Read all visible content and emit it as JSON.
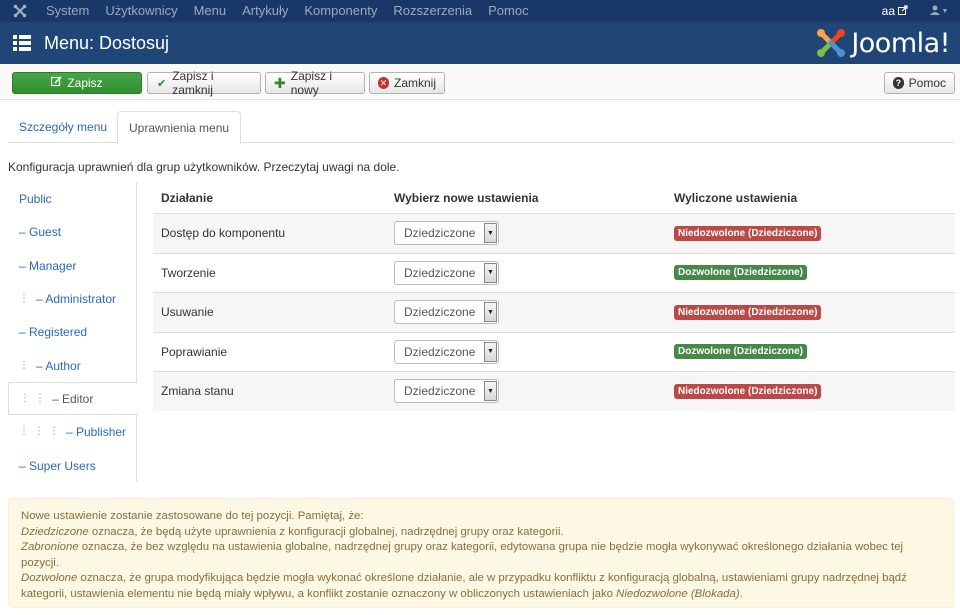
{
  "topnav": {
    "items": [
      "System",
      "Użytkownicy",
      "Menu",
      "Artykuły",
      "Komponenty",
      "Rozszerzenia",
      "Pomoc"
    ],
    "site_label": "aa"
  },
  "header": {
    "title": "Menu: Dostosuj",
    "logo_text": "Joomla!"
  },
  "toolbar": {
    "save": "Zapisz",
    "save_close": "Zapisz i zamknij",
    "save_new": "Zapisz i nowy",
    "close": "Zamknij",
    "help": "Pomoc"
  },
  "tabs": [
    "Szczegóły menu",
    "Uprawnienia menu"
  ],
  "intro": "Konfiguracja uprawnień dla grup użytkowników. Przeczytaj uwagi na dole.",
  "groups": [
    {
      "label": "Public",
      "depth": 0,
      "prefix": ""
    },
    {
      "label": "– Guest",
      "depth": 0,
      "prefix": ""
    },
    {
      "label": "– Manager",
      "depth": 0,
      "prefix": ""
    },
    {
      "label": "– Administrator",
      "depth": 1,
      "prefix": "⋮"
    },
    {
      "label": "– Registered",
      "depth": 0,
      "prefix": ""
    },
    {
      "label": "– Author",
      "depth": 1,
      "prefix": "⋮"
    },
    {
      "label": "– Editor",
      "depth": 2,
      "prefix": "⋮⋮"
    },
    {
      "label": "– Publisher",
      "depth": 3,
      "prefix": "⋮⋮⋮"
    },
    {
      "label": "– Super Users",
      "depth": 0,
      "prefix": ""
    }
  ],
  "table": {
    "headers": [
      "Działanie",
      "Wybierz nowe ustawienia",
      "Wyliczone ustawienia"
    ],
    "rows": [
      {
        "action": "Dostęp do komponentu",
        "select": "Dziedziczone",
        "calc": "Niedozwolone (Dziedziczone)",
        "status": "red"
      },
      {
        "action": "Tworzenie",
        "select": "Dziedziczone",
        "calc": "Dozwolone (Dziedziczone)",
        "status": "green"
      },
      {
        "action": "Usuwanie",
        "select": "Dziedziczone",
        "calc": "Niedozwolone (Dziedziczone)",
        "status": "red"
      },
      {
        "action": "Poprawianie",
        "select": "Dziedziczone",
        "calc": "Dozwolone (Dziedziczone)",
        "status": "green"
      },
      {
        "action": "Zmiana stanu",
        "select": "Dziedziczone",
        "calc": "Niedozwolone (Dziedziczone)",
        "status": "red"
      }
    ]
  },
  "notice": {
    "line1": "Nowe ustawienie zostanie zastosowane do tej pozycji. Pamiętaj, że:",
    "term1": "Dziedziczone",
    "desc1": " oznacza, że będą użyte uprawnienia z konfiguracji globalnej, nadrzędnej grupy oraz kategorii.",
    "term2": "Zabronione",
    "desc2": " oznacza, że bez względu na ustawienia globalne, nadrzędnej grupy oraz kategorii, edytowana grupa nie będzie mogła wykonywać określonego działania wobec tej pozycji.",
    "term3": "Dozwolone",
    "desc3": " oznacza, że grupa modyfikująca będzie mogła wykonać określone działanie, ale w przypadku konfliktu z konfiguracją globalną, ustawieniami grupy nadrzędnej bądź kategorii, ustawienia elementu nie będą miały wpływu, a konflikt zostanie oznaczony w obliczonych ustawieniach jako ",
    "term4": "Niedozwolone (Blokada)",
    "end": "."
  },
  "colors": {
    "topnav": "#1a3867",
    "header": "#1f4677",
    "save_green": "#46a546",
    "badge_red": "#b94a48",
    "badge_green": "#468847",
    "link": "#2a69b8",
    "notice_bg": "#fcf8e3"
  }
}
